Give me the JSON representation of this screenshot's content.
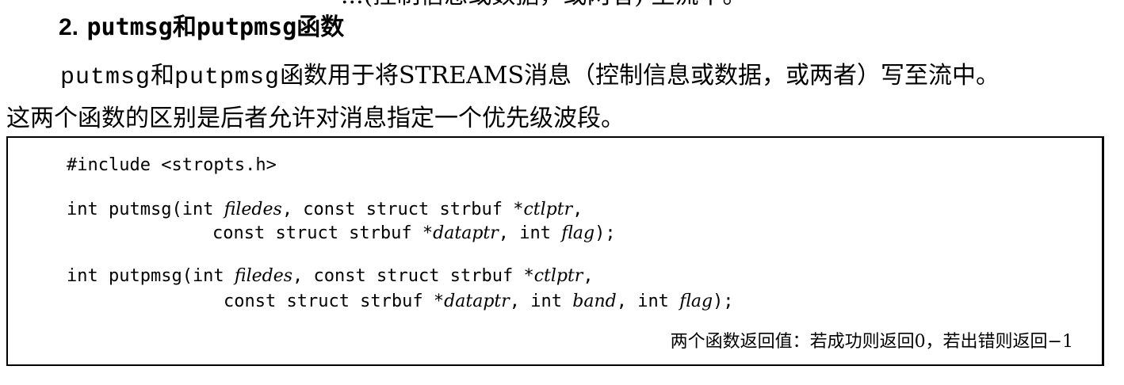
{
  "cut_line": "...(控制信息或数据，或两者) 至流中。",
  "section": {
    "number": "2.",
    "title_code": "putmsg",
    "title_and": "和",
    "title_code2": "putpmsg",
    "title_suffix": "函数"
  },
  "paragraph": {
    "code1": "putmsg",
    "and": "和",
    "code2": "putpmsg",
    "line1_rest": "函数用于将STREAMS消息（控制信息或数据，或两者）写至流中。",
    "line2": "这两个函数的区别是后者允许对消息指定一个优先级波段。"
  },
  "synopsis": {
    "include": "#include <stropts.h>",
    "putmsg": {
      "l1_a": "int putmsg(int ",
      "filedes": "filedes",
      "l1_b": ", const struct strbuf *",
      "ctlptr": "ctlptr",
      "l1_c": ",",
      "l2_a": "const struct strbuf *",
      "dataptr": "dataptr",
      "l2_b": ", int ",
      "flag": "flag",
      "l2_c": ");"
    },
    "putpmsg": {
      "l1_a": "int putpmsg(int ",
      "filedes": "filedes",
      "l1_b": ", const struct strbuf *",
      "ctlptr": "ctlptr",
      "l1_c": ",",
      "l2_a": "const struct strbuf *",
      "dataptr": "dataptr",
      "l2_b": ", int ",
      "band": "band",
      "l2_c": ", int ",
      "flag": "flag",
      "l2_d": ");"
    },
    "return_note": "两个函数返回值：若成功则返回0，若出错则返回−1"
  }
}
